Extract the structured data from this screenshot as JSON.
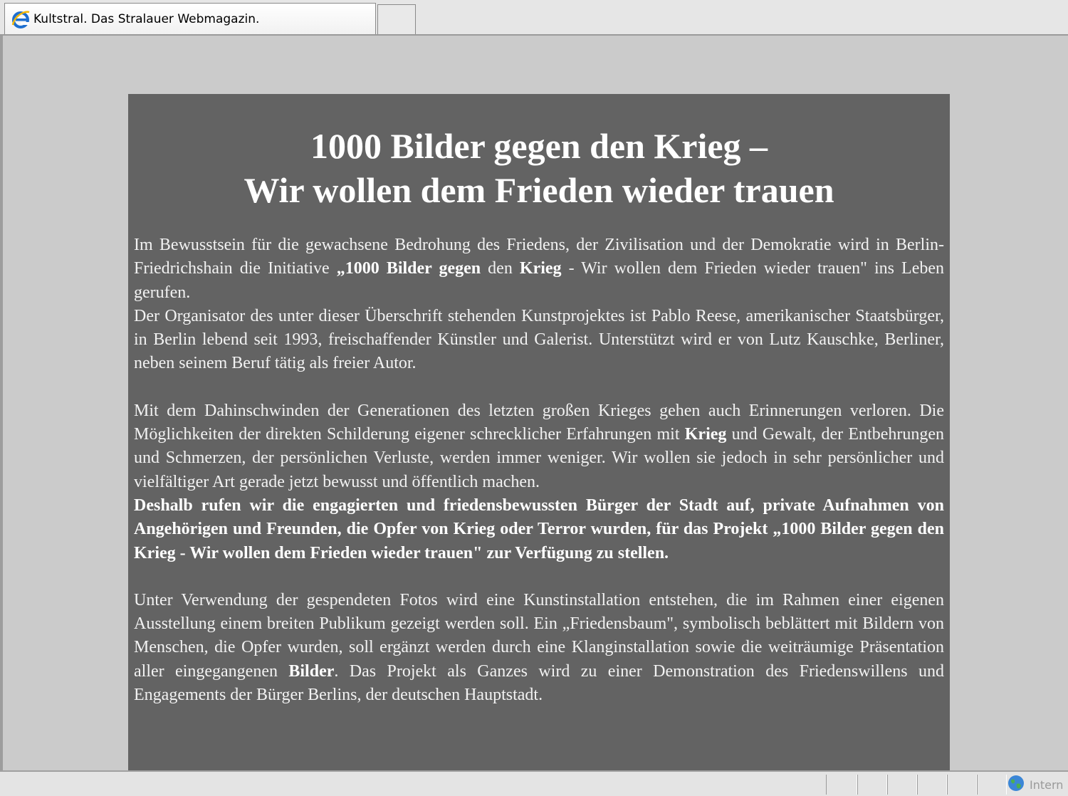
{
  "browser": {
    "tab_title": "Kultstral. Das Stralauer Webmagazin.",
    "tab_icon": "ie-browser-icon",
    "status_zone_label": "Intern",
    "status_zone_icon": "internet-globe-icon"
  },
  "article": {
    "headline_line1": "1000 Bilder gegen den Krieg –",
    "headline_line2": "Wir wollen dem Frieden wieder trauen",
    "p1": {
      "part1": "Im Bewusstsein für die gewachsene Bedrohung des Friedens, der Zivilisation und der Demokratie wird in Berlin-Friedrichshain die Initiative ",
      "bold1": "„1000 Bilder gegen",
      "part2": " den ",
      "bold2": "Krieg",
      "part3": " - Wir wollen dem Frieden wieder trauen\" ins Leben gerufen."
    },
    "p2": "Der Organisator des unter dieser Überschrift stehenden Kunstprojektes ist Pablo Reese, amerikanischer Staatsbürger, in Berlin lebend seit 1993, freischaffender Künstler und Galerist. Unterstützt wird er von Lutz Kauschke, Berliner, neben seinem Beruf tätig als freier Autor.",
    "p3": {
      "part1": "Mit dem Dahinschwinden der Generationen des letzten großen Krieges gehen auch Erinnerungen verloren. Die Möglichkeiten der direkten Schilderung eigener schrecklicher Erfahrungen mit ",
      "bold1": "Krieg",
      "part2": " und Gewalt, der Entbehrungen und Schmerzen, der persönlichen Verluste, werden immer weniger. Wir wollen sie jedoch in sehr persönlicher und vielfältiger Art gerade jetzt bewusst und öffentlich machen."
    },
    "p4": "Deshalb rufen wir die engagierten und friedensbewussten Bürger der Stadt auf, private Aufnahmen von Angehörigen und Freunden, die Opfer von Krieg oder Terror wurden, für das Projekt „1000 Bilder gegen den Krieg - Wir wollen dem Frieden wieder trauen\" zur Verfügung zu stellen.",
    "p5": {
      "part1": "Unter Verwendung der gespendeten Fotos wird eine Kunstinstallation entstehen, die im Rahmen einer eigenen Ausstellung einem breiten Publikum gezeigt werden soll. Ein „Friedensbaum\", symbolisch beblättert mit Bildern von Menschen, die Opfer wurden, soll ergänzt werden durch eine Klanginstallation sowie die weiträumige Präsentation aller eingegangenen ",
      "bold1": "Bilder",
      "part2": ". Das Projekt als Ganzes wird zu einer Demonstration des Friedenswillens und Engagements der Bürger Berlins, der deutschen Hauptstadt."
    }
  }
}
